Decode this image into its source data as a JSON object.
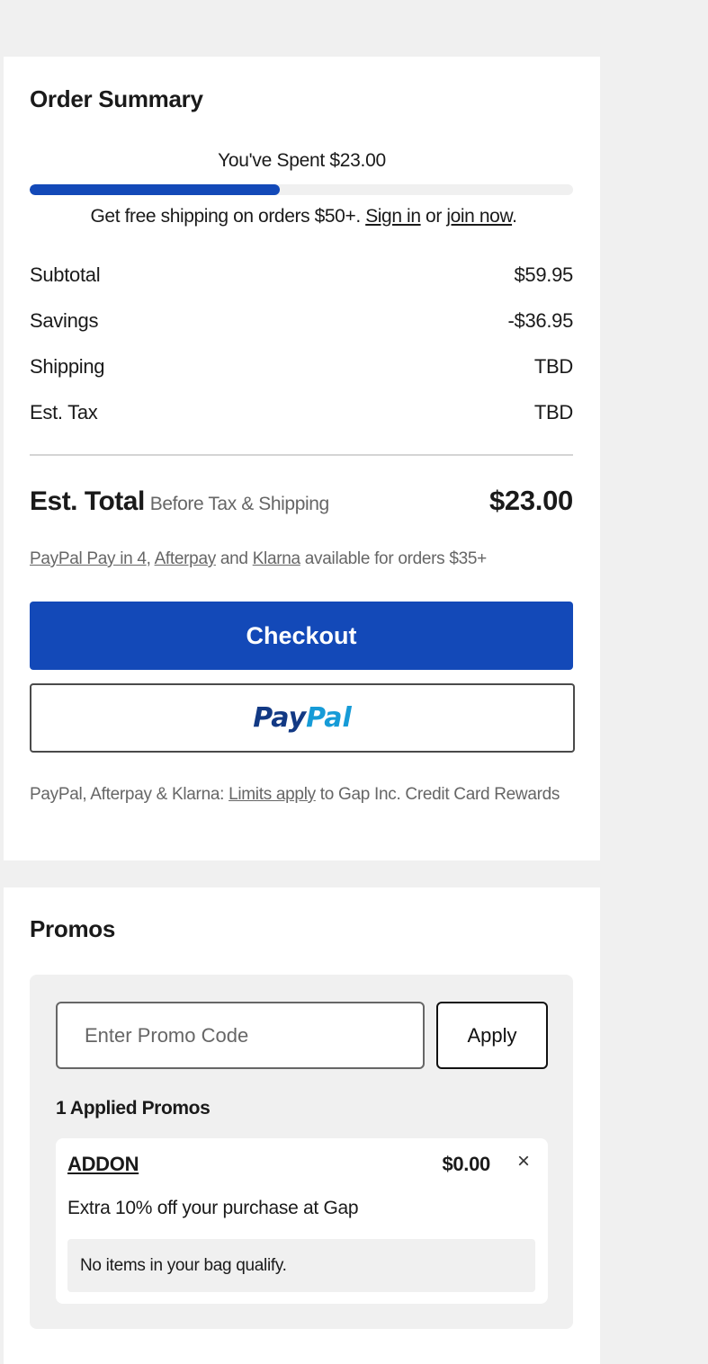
{
  "order_summary": {
    "title": "Order Summary",
    "progress_label": "You've Spent $23.00",
    "progress_fraction": 0.46,
    "free_shipping": {
      "prefix": "Get free shipping on orders $50+. ",
      "sign_in": "Sign in",
      "or": " or ",
      "join_now": "join now",
      "suffix": "."
    },
    "rows": [
      {
        "label": "Subtotal",
        "value": "$59.95"
      },
      {
        "label": "Savings",
        "value": "-$36.95"
      },
      {
        "label": "Shipping",
        "value": "TBD"
      },
      {
        "label": "Est. Tax",
        "value": "TBD"
      }
    ],
    "total": {
      "label": "Est. Total",
      "sublabel": "Before Tax & Shipping",
      "value": "$23.00"
    },
    "bnpl": {
      "paypal": "PayPal Pay in 4",
      "comma": ", ",
      "afterpay": "Afterpay",
      "and": " and ",
      "klarna": "Klarna",
      "suffix": " available for orders $35+"
    },
    "checkout_label": "Checkout",
    "paypal_button": {
      "part1": "Pay",
      "part2": "Pal"
    },
    "disclaimer": {
      "prefix": "PayPal, Afterpay & Klarna: ",
      "link": "Limits apply",
      "suffix": " to Gap Inc. Credit Card Rewards"
    }
  },
  "promos": {
    "title": "Promos",
    "input_placeholder": "Enter Promo Code",
    "apply_label": "Apply",
    "applied_label": "1 Applied Promos",
    "applied": [
      {
        "code": "ADDON",
        "amount": "$0.00",
        "remove_icon": "×",
        "description": "Extra 10% off your purchase at Gap",
        "note": "No items in your bag qualify."
      }
    ]
  },
  "colors": {
    "accent": "#1349b8",
    "paypal_dark": "#123984",
    "paypal_light": "#169bd7",
    "background": "#f0f0f0"
  }
}
